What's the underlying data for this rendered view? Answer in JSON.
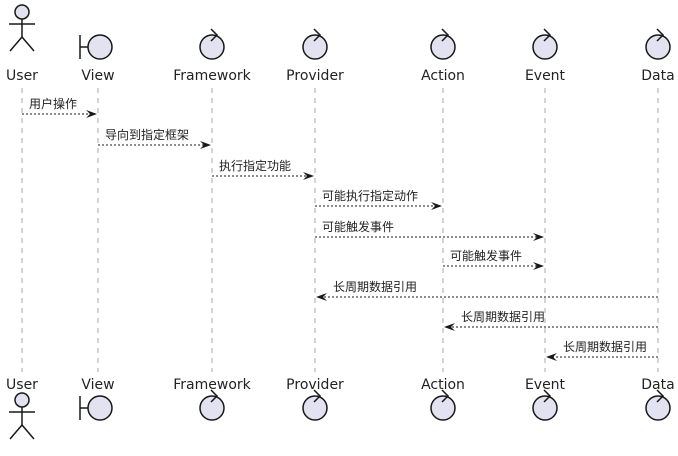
{
  "participants": [
    {
      "id": "user",
      "label": "User",
      "kind": "actor-icon"
    },
    {
      "id": "view",
      "label": "View",
      "kind": "boundary-icon"
    },
    {
      "id": "framework",
      "label": "Framework",
      "kind": "control-icon"
    },
    {
      "id": "provider",
      "label": "Provider",
      "kind": "control-icon"
    },
    {
      "id": "action",
      "label": "Action",
      "kind": "control-icon"
    },
    {
      "id": "event",
      "label": "Event",
      "kind": "control-icon"
    },
    {
      "id": "data",
      "label": "Data",
      "kind": "control-icon"
    }
  ],
  "messages": [
    {
      "from": "user",
      "to": "view",
      "label": "用户操作"
    },
    {
      "from": "view",
      "to": "framework",
      "label": "导向到指定框架"
    },
    {
      "from": "framework",
      "to": "provider",
      "label": "执行指定功能"
    },
    {
      "from": "provider",
      "to": "action",
      "label": "可能执行指定动作"
    },
    {
      "from": "provider",
      "to": "event",
      "label": "可能触发事件"
    },
    {
      "from": "action",
      "to": "event",
      "label": "可能触发事件"
    },
    {
      "from": "data",
      "to": "provider",
      "label": "长周期数据引用"
    },
    {
      "from": "data",
      "to": "action",
      "label": "长周期数据引用"
    },
    {
      "from": "data",
      "to": "event",
      "label": "长周期数据引用"
    }
  ],
  "colors": {
    "participant_fill": "#e2e2f0",
    "stroke": "#181818",
    "lifeline": "#a8a8a8"
  }
}
